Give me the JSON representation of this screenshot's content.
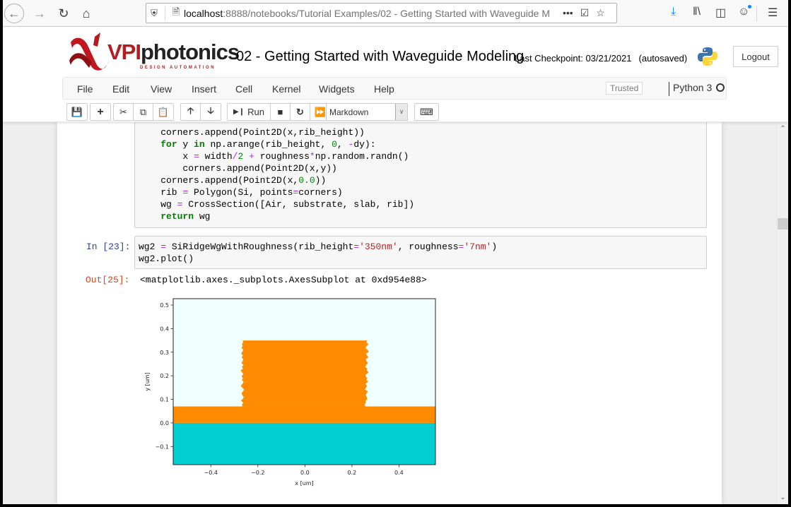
{
  "browser": {
    "url_host": "localhost",
    "url_rest": ":8888/notebooks/Tutorial Examples/02 - Getting Started with Waveguide M",
    "icons": [
      "back-icon",
      "forward-icon",
      "reload-icon",
      "home-icon",
      "shield-icon",
      "page-icon",
      "more-icon",
      "pocket-icon",
      "bookmark-star-icon",
      "download-icon",
      "library-icon",
      "sidebar-icon",
      "account-icon",
      "menu-icon"
    ],
    "more_glyph": "•••"
  },
  "header": {
    "logo_text": "VPIphotonics",
    "logo_vpi": "VPI",
    "logo_rest": "photonics",
    "logo_tagline": "DESIGN AUTOMATION",
    "notebook_title": "02 - Getting Started with Waveguide Modeling",
    "checkpoint": "Last Checkpoint: 03/21/2021",
    "autosaved": "(autosaved)",
    "logout_label": "Logout"
  },
  "menubar": {
    "items": [
      "File",
      "Edit",
      "View",
      "Insert",
      "Cell",
      "Kernel",
      "Widgets",
      "Help"
    ],
    "trusted_label": "Trusted",
    "kernel_name": "Python 3"
  },
  "toolbar": {
    "run_label": "Run",
    "cell_type": "Markdown",
    "buttons": [
      "save",
      "insert-cell-below",
      "cut",
      "copy",
      "paste",
      "move-up",
      "move-down",
      "run",
      "interrupt",
      "restart",
      "restart-run-all",
      "command-palette"
    ]
  },
  "cells": {
    "code_prev": {
      "lines": [
        "    corners.append(Point2D(x,rib_height))",
        "    for y in np.arange(rib_height, 0, -dy):",
        "        x = width/2 + roughness*np.random.randn()",
        "        corners.append(Point2D(x,y))",
        "    corners.append(Point2D(x,0.0))",
        "    rib = Polygon(Si, points=corners)",
        "    wg = CrossSection([Air, substrate, slab, rib])",
        "    return wg"
      ]
    },
    "code_current": {
      "prompt": "In [23]:",
      "lines": [
        "wg2 = SiRidgeWgWithRoughness(rib_height='350nm', roughness='7nm')",
        "wg2.plot()"
      ]
    },
    "output": {
      "prompt": "Out[25]:",
      "text": "<matplotlib.axes._subplots.AxesSubplot at 0xd954e88>"
    }
  },
  "chart_data": {
    "type": "area",
    "title": "",
    "xlabel": "x [um]",
    "ylabel": "y [um]",
    "xlim": [
      -0.56,
      0.555
    ],
    "ylim": [
      -0.177,
      0.527
    ],
    "xticks": [
      -0.4,
      -0.2,
      0.0,
      0.2,
      0.4
    ],
    "xtick_labels": [
      "−0.4",
      "−0.2",
      "0.0",
      "0.2",
      "0.4"
    ],
    "yticks": [
      -0.1,
      0.0,
      0.1,
      0.2,
      0.3,
      0.4,
      0.5
    ],
    "ytick_labels": [
      "−0.1",
      "0.0",
      "0.1",
      "0.2",
      "0.3",
      "0.4",
      "0.5"
    ],
    "grid": false,
    "regions": [
      {
        "name": "Air",
        "color": "#f0ffff",
        "y_range": [
          -0.177,
          0.527
        ]
      },
      {
        "name": "substrate",
        "color": "#00ced1",
        "y_range": [
          -0.177,
          0.0
        ]
      },
      {
        "name": "slab",
        "color": "#ff8c00",
        "y_range": [
          0.0,
          0.07
        ]
      },
      {
        "name": "rib",
        "color": "#ff8c00",
        "width": 0.53,
        "rib_height": 0.35,
        "roughness": 0.007
      }
    ],
    "rib_right_edge_x": [
      0.265,
      0.262,
      0.27,
      0.263,
      0.258,
      0.266,
      0.272,
      0.26,
      0.264,
      0.27,
      0.259,
      0.262,
      0.268,
      0.261,
      0.256,
      0.266,
      0.263,
      0.271,
      0.26,
      0.258,
      0.265,
      0.262,
      0.269,
      0.257,
      0.264,
      0.26,
      0.255,
      0.268,
      0.262,
      0.259,
      0.263,
      0.266,
      0.258,
      0.26,
      0.254,
      0.257
    ],
    "rib_left_edge_x": [
      -0.265,
      -0.268,
      -0.262,
      -0.272,
      -0.264,
      -0.26,
      -0.266,
      -0.27,
      -0.263,
      -0.259,
      -0.267,
      -0.273,
      -0.265,
      -0.261,
      -0.268,
      -0.264,
      -0.27,
      -0.262,
      -0.266,
      -0.274,
      -0.263,
      -0.268,
      -0.261,
      -0.27,
      -0.265,
      -0.262,
      -0.269,
      -0.264,
      -0.271,
      -0.266,
      -0.262,
      -0.27,
      -0.265,
      -0.268,
      -0.263,
      -0.264
    ]
  }
}
